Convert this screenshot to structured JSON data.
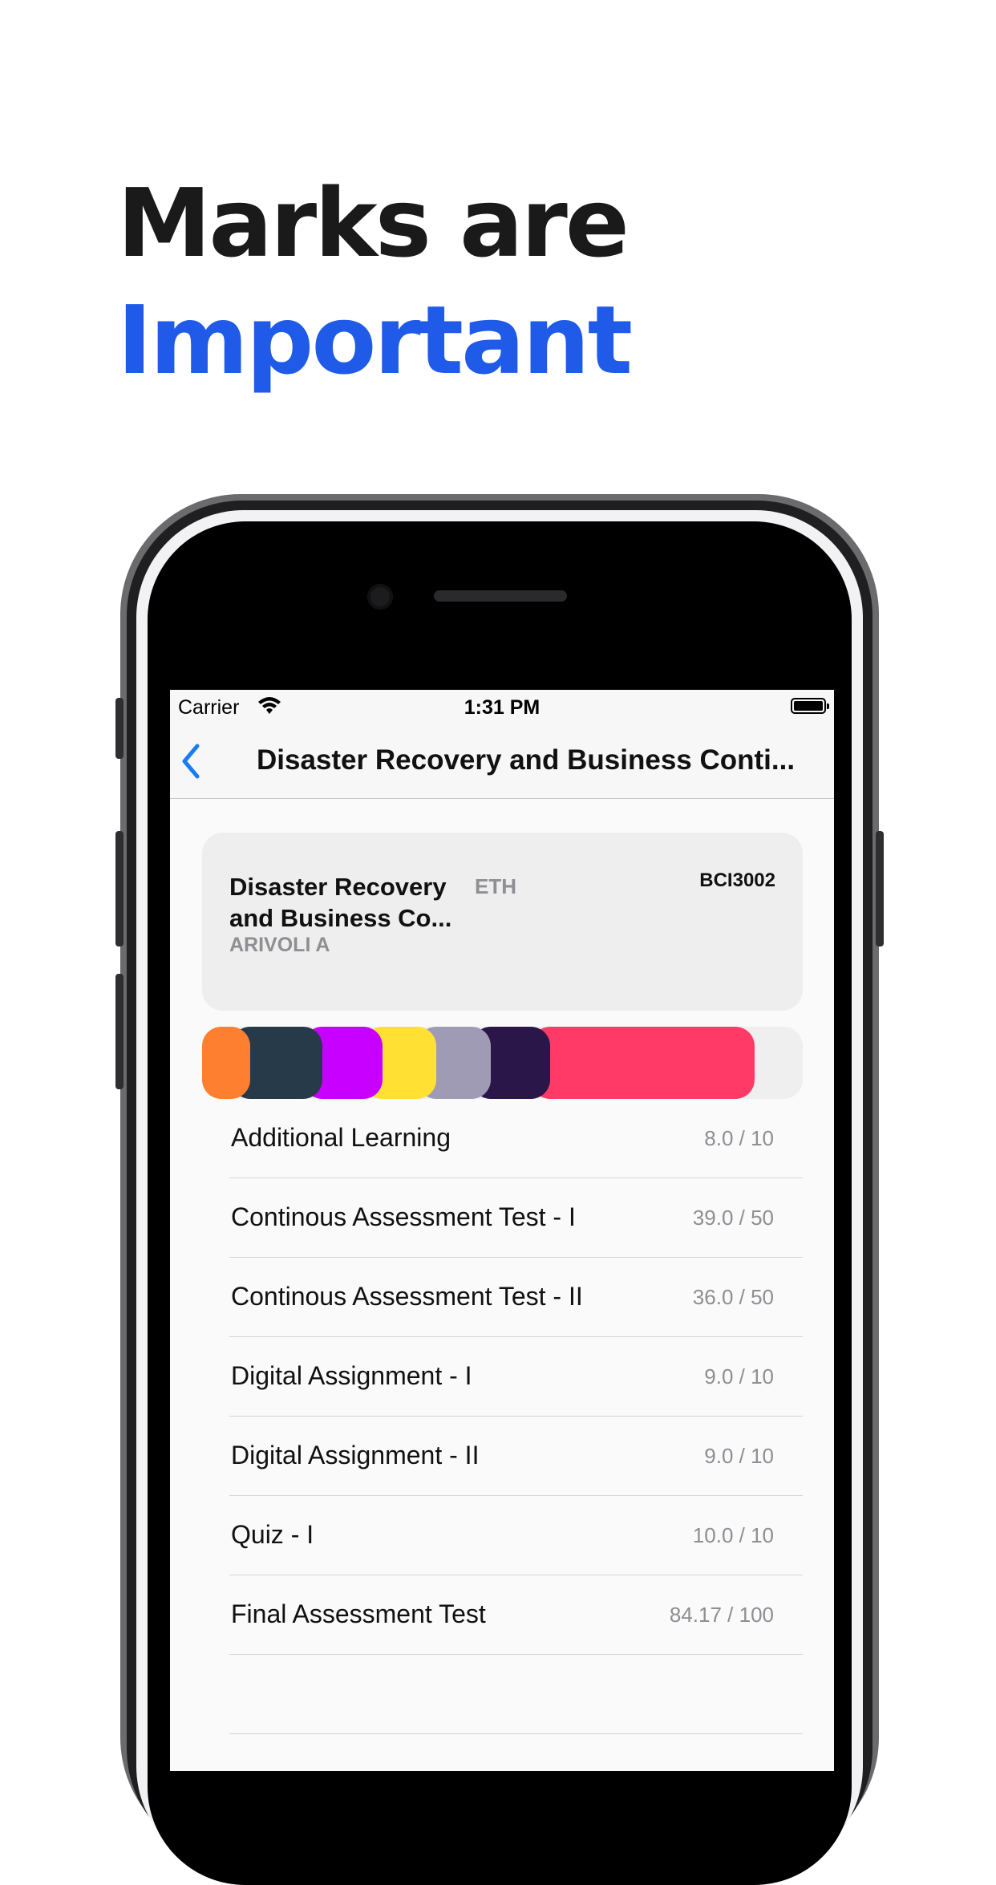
{
  "headline": {
    "line1": "Marks are",
    "line2": "Important"
  },
  "status_bar": {
    "carrier": "Carrier",
    "time": "1:31 PM"
  },
  "nav": {
    "title": "Disaster Recovery and Business Conti..."
  },
  "course": {
    "title": "Disaster Recovery and Business Co...",
    "type": "ETH",
    "faculty": "ARIVOLI A",
    "code": "BCI3002"
  },
  "marks_bar": {
    "segments": [
      {
        "color": "#ff7f30",
        "share": 0.08
      },
      {
        "color": "#263a4a",
        "share": 0.12
      },
      {
        "color": "#c800ff",
        "share": 0.1
      },
      {
        "color": "#ffe033",
        "share": 0.09
      },
      {
        "color": "#a09bb5",
        "share": 0.09
      },
      {
        "color": "#2a1648",
        "share": 0.1
      },
      {
        "color": "#ff3a66",
        "share": 0.34
      }
    ]
  },
  "marks": [
    {
      "name": "Additional Learning",
      "score": "8.0 / 10"
    },
    {
      "name": "Continous Assessment Test - I",
      "score": "39.0 / 50"
    },
    {
      "name": "Continous Assessment Test - II",
      "score": "36.0 / 50"
    },
    {
      "name": "Digital Assignment - I",
      "score": "9.0 / 10"
    },
    {
      "name": "Digital Assignment - II",
      "score": "9.0 / 10"
    },
    {
      "name": "Quiz - I",
      "score": "10.0 / 10"
    },
    {
      "name": "Final Assessment Test",
      "score": "84.17 / 100"
    }
  ]
}
